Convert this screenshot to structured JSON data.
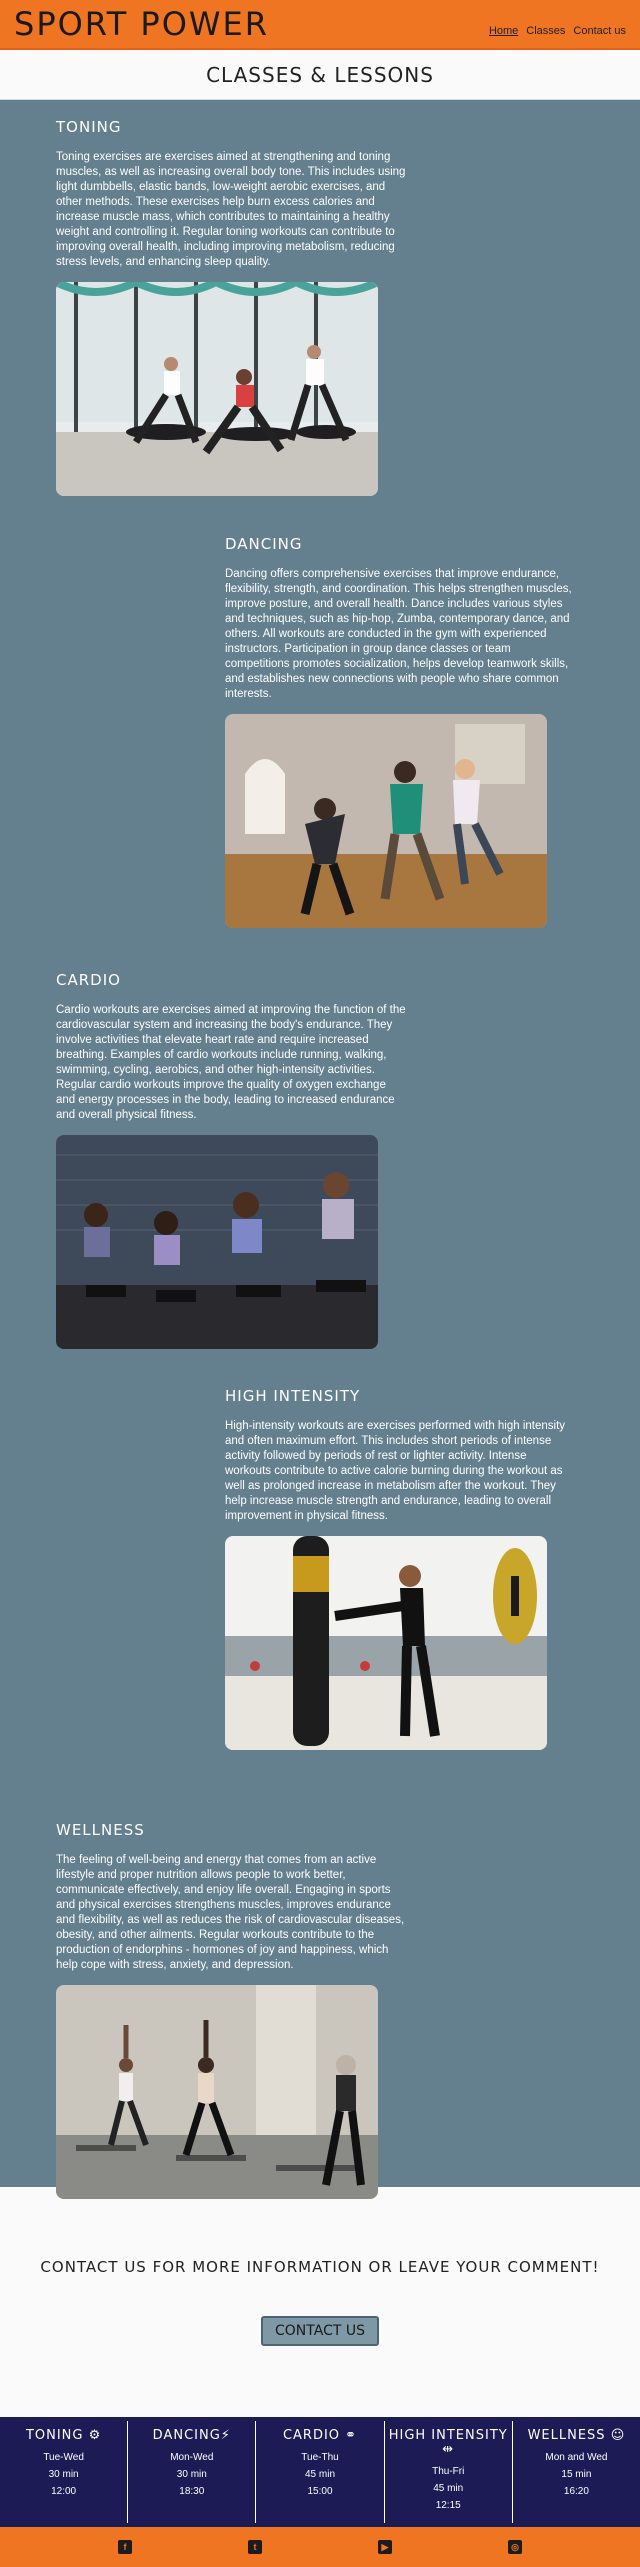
{
  "header": {
    "brand": "SPORT POWER",
    "nav": [
      "Home",
      "Classes",
      "Contact us"
    ]
  },
  "page_title": "CLASSES & LESSONS",
  "classes": [
    {
      "title": "TONING",
      "text": "Toning exercises are exercises aimed at strengthening and toning muscles, as well as increasing overall body tone. This includes using light dumbbells, elastic bands, low-weight aerobic exercises, and other methods. These exercises help burn excess calories and increase muscle mass, which contributes to maintaining a healthy weight and controlling it. Regular toning workouts can contribute to improving overall health, including improving metabolism, reducing stress levels, and enhancing sleep quality."
    },
    {
      "title": "DANCING",
      "text": "Dancing offers comprehensive exercises that improve endurance, flexibility, strength, and coordination. This helps strengthen muscles, improve posture, and overall health. Dance includes various styles and techniques, such as hip-hop, Zumba, contemporary dance, and others. All workouts are conducted in the gym with experienced instructors. Participation in group dance classes or team competitions promotes socialization, helps develop teamwork skills, and establishes new connections with people who share common interests."
    },
    {
      "title": "CARDIO",
      "text": "Cardio workouts are exercises aimed at improving the function of the cardiovascular system and increasing the body's endurance. They involve activities that elevate heart rate and require increased breathing. Examples of cardio workouts include running, walking, swimming, cycling, aerobics, and other high-intensity activities. Regular cardio workouts improve the quality of oxygen exchange and energy processes in the body, leading to increased endurance and overall physical fitness."
    },
    {
      "title": "HIGH INTENSITY",
      "text": "High-intensity workouts are exercises performed with high intensity and often maximum effort. This includes short periods of intense activity followed by periods of rest or lighter activity. Intense workouts contribute to active calorie burning during the workout as well as prolonged increase in metabolism after the workout. They help increase muscle strength and endurance, leading to overall improvement in physical fitness."
    },
    {
      "title": "WELLNESS",
      "text": "The feeling of well-being and energy that comes from an active lifestyle and proper nutrition allows people to work better, communicate effectively, and enjoy life overall. Engaging in sports and physical exercises strengthens muscles, improves endurance and flexibility, as well as reduces the risk of cardiovascular diseases, obesity, and other ailments. Regular workouts contribute to the production of endorphins - hormones of joy and happiness, which help cope with stress, anxiety, and depression."
    }
  ],
  "contact": {
    "text": "CONTACT US FOR MORE INFORMATION OR LEAVE YOUR COMMENT!",
    "button": "CONTACT US"
  },
  "schedule": [
    {
      "name": "TONING",
      "days": "Tue-Wed",
      "duration": "30 min",
      "time": "12:00",
      "icon": "dumbbell-icon"
    },
    {
      "name": "DANCING",
      "days": "Mon-Wed",
      "duration": "30 min",
      "time": "18:30",
      "icon": "lightning-icon"
    },
    {
      "name": "CARDIO",
      "days": "Tue-Thu",
      "duration": "45 min",
      "time": "15:00",
      "icon": "bicycle-icon"
    },
    {
      "name": "HIGH INTENSITY",
      "days": "Thu-Fri",
      "duration": "45 min",
      "time": "12:15",
      "icon": "weight-icon"
    },
    {
      "name": "WELLNESS",
      "days": "Mon and Wed",
      "duration": "15 min",
      "time": "16:20",
      "icon": "meditation-icon"
    }
  ],
  "footer_icons": [
    "facebook-icon",
    "twitter-icon",
    "youtube-icon",
    "instagram-icon"
  ],
  "colors": {
    "header": "#f07522",
    "classes_bg": "#64808f",
    "schedule_bg": "#1c1b55"
  }
}
